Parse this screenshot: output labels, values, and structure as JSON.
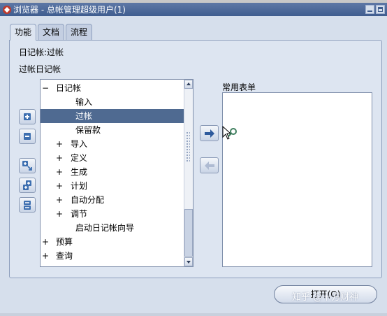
{
  "window": {
    "title": "浏览器 - 总帐管理超级用户(1)"
  },
  "tabs": [
    {
      "label": "功能",
      "active": true
    },
    {
      "label": "文档",
      "active": false
    },
    {
      "label": "流程",
      "active": false
    }
  ],
  "labels": {
    "journal": "日记帐:过帐",
    "posting": "过帐日记帐"
  },
  "tree": {
    "items": [
      {
        "label": "日记帐",
        "expander": "−",
        "level": 0,
        "selected": false
      },
      {
        "label": "输入",
        "expander": "",
        "level": 2,
        "selected": false
      },
      {
        "label": "过帐",
        "expander": "",
        "level": 2,
        "selected": true
      },
      {
        "label": "保留款",
        "expander": "",
        "level": 2,
        "selected": false
      },
      {
        "label": "导入",
        "expander": "+",
        "level": 1,
        "selected": false
      },
      {
        "label": "定义",
        "expander": "+",
        "level": 1,
        "selected": false
      },
      {
        "label": "生成",
        "expander": "+",
        "level": 1,
        "selected": false
      },
      {
        "label": "计划",
        "expander": "+",
        "level": 1,
        "selected": false
      },
      {
        "label": "自动分配",
        "expander": "+",
        "level": 1,
        "selected": false
      },
      {
        "label": "调节",
        "expander": "+",
        "level": 1,
        "selected": false
      },
      {
        "label": "启动日记帐向导",
        "expander": "",
        "level": 2,
        "selected": false
      },
      {
        "label": "预算",
        "expander": "+",
        "level": 0,
        "selected": false
      },
      {
        "label": "查询",
        "expander": "+",
        "level": 0,
        "selected": false
      }
    ]
  },
  "favorites": {
    "label": "常用表单",
    "items": []
  },
  "buttons": {
    "open": "打开(O)"
  },
  "watermark": "知乎 @十方财神",
  "icons": {
    "expand": "plus-icon",
    "collapse": "minus-icon",
    "expand_branch": "expand-branch-icon",
    "expand_all": "expand-all-icon",
    "collapse_all": "collapse-all-icon",
    "add": "arrow-right-icon",
    "remove": "arrow-left-icon"
  },
  "colors": {
    "accent": "#4f6a91",
    "titlebar": "#3f5d8f",
    "panel": "#dde5f1"
  }
}
